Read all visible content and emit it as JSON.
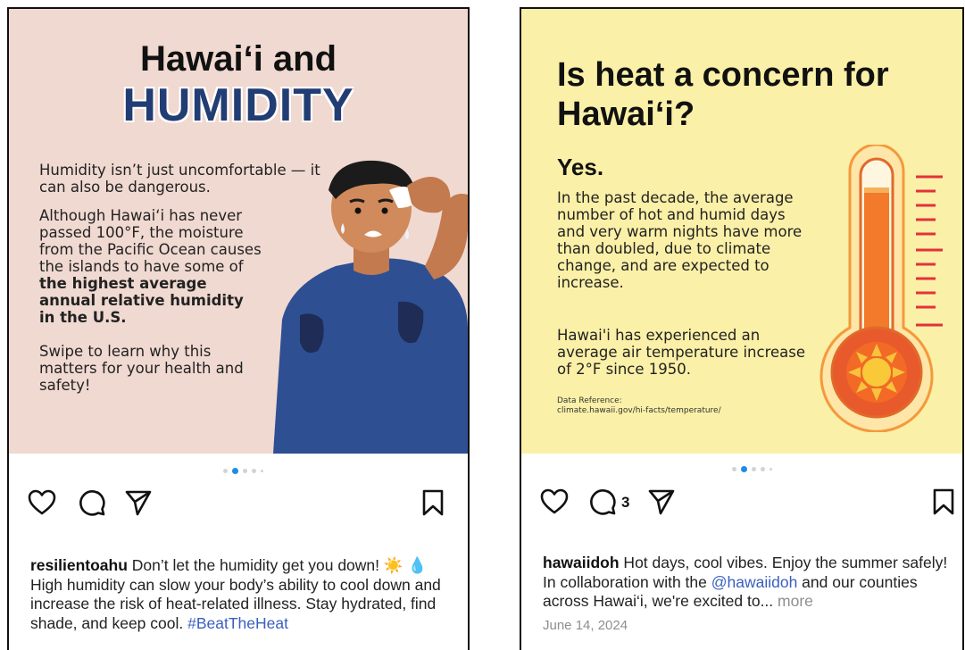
{
  "left_post": {
    "image": {
      "title_line1": "Hawai‘i and",
      "title_line2": "HUMIDITY",
      "para1": "Humidity isn’t just uncomfortable — it can also be dangerous.",
      "para2_a": "Although Hawai‘i has never passed 100°F, the moisture from the Pacific Ocean causes the islands to have some of ",
      "para2_bold": "the highest average annual relative humidity in the U.S.",
      "para3": "Swipe to learn why this matters for your health and safety!"
    },
    "carousel": {
      "total": 5,
      "active_index": 1
    },
    "actions": {
      "like": "heart-icon",
      "comment": "comment-icon",
      "share": "send-icon",
      "save": "bookmark-icon"
    },
    "caption": {
      "username": "resilientoahu",
      "text": " Don’t let the humidity get you down! ☀️ 💧 High humidity can slow your body’s ability to cool down and increase the risk of heat-related illness. Stay hydrated, find shade, and keep cool. ",
      "hashtag": "#BeatTheHeat"
    }
  },
  "right_post": {
    "image": {
      "title": "Is heat a concern for Hawai‘i?",
      "yes": "Yes.",
      "para1": "In the past decade, the average number of hot and humid days and very warm nights have more than doubled, due to climate change, and are expected to increase.",
      "para2": "Hawai'i has experienced an average air temperature increase of 2°F since 1950.",
      "reference_label": "Data Reference:",
      "reference_url": "climate.hawaii.gov/hi-facts/temperature/"
    },
    "carousel": {
      "total": 5,
      "active_index": 1
    },
    "actions": {
      "like": "heart-icon",
      "comment": "comment-icon",
      "comment_count": "3",
      "share": "send-icon",
      "save": "bookmark-icon"
    },
    "caption": {
      "username": "hawaiidoh",
      "text_a": " Hot days, cool vibes. Enjoy the summer safely! In collaboration with the ",
      "mention": "@hawaiidoh",
      "text_b": " and our counties across Hawai‘i, we're excited to... ",
      "more": "more"
    },
    "date": "June 14, 2024"
  },
  "colors": {
    "left_bg": "#f0d9d1",
    "right_bg": "#fbf0a7",
    "humidity_blue": "#223d73",
    "link_blue": "#3a5fbf",
    "dot_active": "#1f8ce6"
  }
}
